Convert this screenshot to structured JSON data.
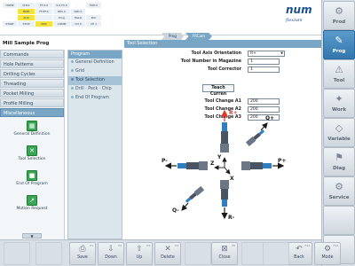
{
  "status_bar": {
    "cells": [
      "HOME",
      "CHC1",
      "FF 0.0",
      "0.0 F0.0",
      ".",
      "FDH.0",
      ".",
      "FREE",
      "FF/FF.0",
      "RPS 0",
      "SPD 0",
      ".",
      ".",
      "AUX",
      "",
      "Prog",
      "HALO",
      "PLC",
      "START",
      "STOP",
      "M02",
      "COMM",
      "CH 0",
      "CH 1"
    ]
  },
  "logo": {
    "brand": "num",
    "tagline": "flexium"
  },
  "breadcrumb": [
    "Prog",
    "FRCam"
  ],
  "page_title": "Mill Sample Prog",
  "categories": [
    "Commands",
    "Hole Patterns",
    "Drilling Cycles",
    "Threading",
    "Pocket Milling",
    "Profile Milling",
    "Miscellaneous"
  ],
  "active_category_index": 6,
  "sub_items": [
    {
      "icon": "definition-icon",
      "label": "General Definition"
    },
    {
      "icon": "tool-selection-icon",
      "label": "Tool Selection"
    },
    {
      "icon": "stop-icon",
      "label": "End Of Program"
    },
    {
      "icon": "motion-request-icon",
      "label": "Motion Request"
    }
  ],
  "program": {
    "header": "Program",
    "items": [
      "General Definition",
      "Grid",
      "Tool Selection",
      "Drill · Peck · Chip",
      "End Of Program"
    ],
    "active_index": 2
  },
  "form": {
    "header": "Tool Selection",
    "fields": [
      {
        "label": "Tool Axis Orientation",
        "value": "R+",
        "type": "select"
      },
      {
        "label": "Tool Number in Magazine",
        "value": "1",
        "type": "text"
      },
      {
        "label": "Tool Corrector",
        "value": "1",
        "type": "text"
      },
      {
        "label": "Tool Change A1",
        "value": "200",
        "type": "text"
      },
      {
        "label": "Tool Change A2",
        "value": "200",
        "type": "text"
      },
      {
        "label": "Tool Change A3",
        "value": "200",
        "type": "text"
      }
    ],
    "teach_button": "Teach Curren"
  },
  "diagram": {
    "labels": [
      "R+",
      "Q+",
      "P-",
      "P+",
      "Q-",
      "R-",
      "Z",
      "Y",
      "X"
    ],
    "colors": {
      "up": "#e0392b",
      "tool": "#4a5564",
      "accent": "#2f7ec0"
    }
  },
  "right_buttons": [
    {
      "label": "Prod",
      "icon": "prod-icon"
    },
    {
      "label": "Prog",
      "icon": "prog-icon",
      "active": true
    },
    {
      "label": "Tool",
      "icon": "tool-icon"
    },
    {
      "label": "Work",
      "icon": "work-icon"
    },
    {
      "label": "Variable",
      "icon": "variable-icon"
    },
    {
      "label": "Diag",
      "icon": "diag-icon"
    },
    {
      "label": "Service",
      "icon": "service-icon"
    },
    {
      "label": "",
      "icon": ""
    },
    {
      "label": "",
      "icon": ""
    }
  ],
  "bottom_buttons": [
    {
      "label": "Save",
      "icon": "save-icon",
      "key": "F1"
    },
    {
      "label": "Down",
      "icon": "down-icon",
      "key": "F2"
    },
    {
      "label": "Up",
      "icon": "up-icon",
      "key": "F3"
    },
    {
      "label": "Delete",
      "icon": "delete-icon",
      "key": "F4"
    },
    {
      "label": "Close",
      "icon": "close-icon",
      "key": "F6"
    },
    {
      "label": "Back",
      "icon": "back-icon",
      "key": "F11"
    },
    {
      "label": "Mode",
      "icon": "mode-icon",
      "key": "F12"
    }
  ]
}
